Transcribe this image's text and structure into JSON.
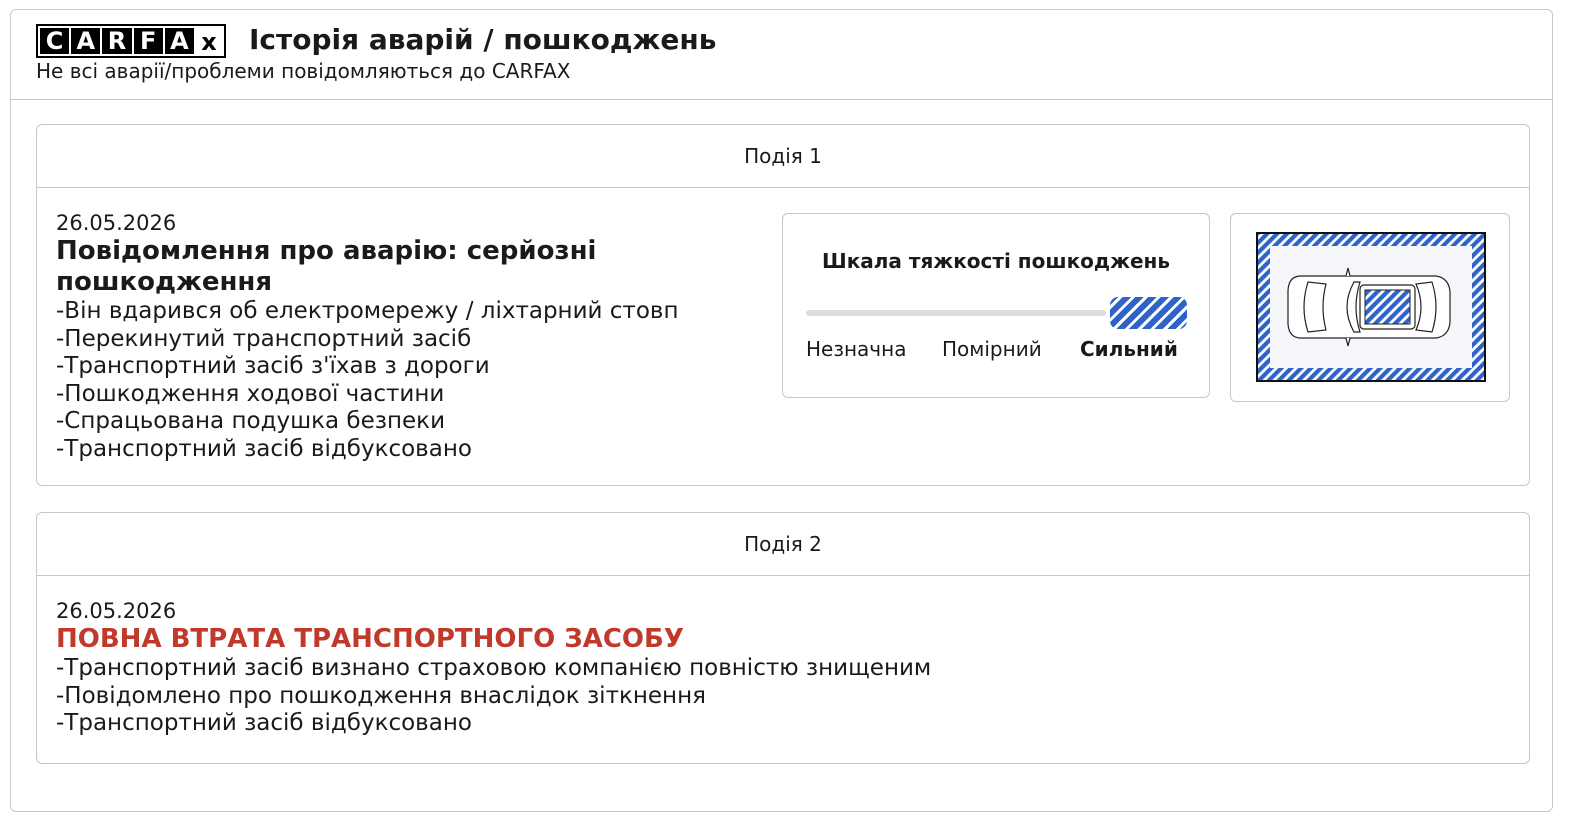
{
  "header": {
    "logo_letters": [
      "C",
      "A",
      "R",
      "F",
      "A"
    ],
    "logo_tail": "x",
    "title": "Історія аварій / пошкоджень",
    "subtitle": "Не всі аварії/проблеми повідомляються до CARFAX"
  },
  "events": [
    {
      "label": "Подія 1",
      "date": "26.05.2026",
      "headline": "Повідомлення про аварію: серйозні пошкодження",
      "items": [
        "-Він вдарився об електромережу / ліхтарний стовп",
        "-Перекинутий транспортний засіб",
        "-Транспортний засіб з'їхав з дороги",
        "-Пошкодження ходової частини",
        "-Спрацьована подушка безпеки",
        "-Транспортний засіб відбуксовано"
      ],
      "severity": {
        "title": "Шкала тяжкості пошкоджень",
        "levels": [
          "Незначна",
          "Помірний",
          "Сильний"
        ],
        "selected": "Сильний"
      },
      "diagram": {
        "icon": "car-top-view-icon",
        "damage_color": "#2f63c8"
      }
    },
    {
      "label": "Подія 2",
      "date": "26.05.2026",
      "headline": "ПОВНА ВТРАТА ТРАНСПОРТНОГО ЗАСОБУ",
      "headline_color": "#c0392b",
      "items": [
        "-Транспортний засіб визнано страховою компанією повністю знищеним",
        "-Повідомлено про пошкодження внаслідок зіткнення",
        "-Транспортний засіб відбуксовано"
      ]
    }
  ]
}
